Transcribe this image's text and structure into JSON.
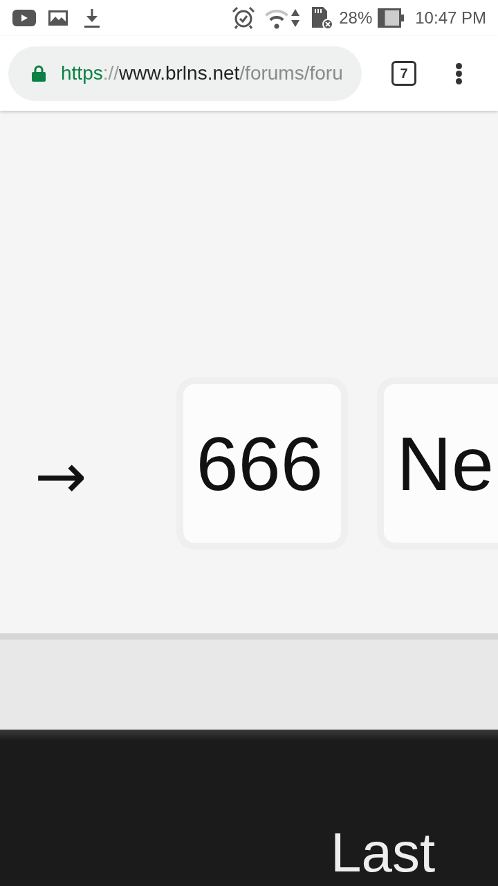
{
  "status_bar": {
    "battery": "28%",
    "time": "10:47 PM"
  },
  "toolbar": {
    "secure": true,
    "url": {
      "scheme": "https",
      "separator": "://",
      "host": "www.brlns.net",
      "path": "/forums/foru"
    },
    "tab_count": "7"
  },
  "pagination": {
    "arrow": "→",
    "pages": [
      {
        "label": "666"
      },
      {
        "label": "Ne"
      }
    ]
  },
  "footer": {
    "heading": "Last"
  }
}
